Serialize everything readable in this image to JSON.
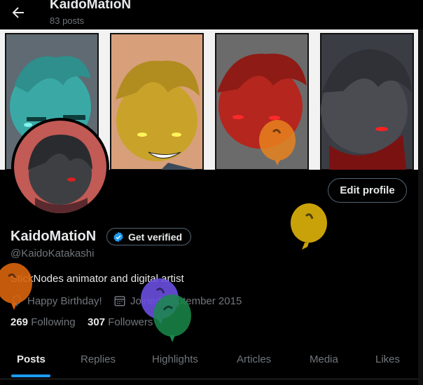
{
  "header": {
    "title": "KaidoMatioN",
    "post_count": "83 posts"
  },
  "banner": {
    "panels": [
      {
        "character": "teal",
        "color": "#3aa9a6"
      },
      {
        "character": "yellow",
        "color": "#c9a22a"
      },
      {
        "character": "red",
        "color": "#b5261e"
      },
      {
        "character": "gray",
        "color": "#4a4c52"
      }
    ]
  },
  "profile": {
    "display_name": "KaidoMatioN",
    "handle": "@KaidoKatakashi",
    "bio": "StickNodes animator and digital artist",
    "birthday": "Happy Birthday!",
    "joined": "Joined September 2015",
    "following_count": "269",
    "following_label": "Following",
    "followers_count": "307",
    "followers_label": "Followers"
  },
  "buttons": {
    "edit_profile": "Edit profile",
    "get_verified": "Get verified"
  },
  "tabs": [
    {
      "label": "Posts",
      "active": true
    },
    {
      "label": "Replies",
      "active": false
    },
    {
      "label": "Highlights",
      "active": false
    },
    {
      "label": "Articles",
      "active": false
    },
    {
      "label": "Media",
      "active": false
    },
    {
      "label": "Likes",
      "active": false
    }
  ],
  "balloons": [
    {
      "color": "#e8831f"
    },
    {
      "color": "#c9a20a"
    },
    {
      "color": "#d9640d"
    },
    {
      "color": "#6a4fe0"
    },
    {
      "color": "#1a8a4a"
    }
  ],
  "colors": {
    "accent": "#1d9bf0",
    "text": "#e7e9ea",
    "muted": "#71767b",
    "border": "#536471"
  }
}
